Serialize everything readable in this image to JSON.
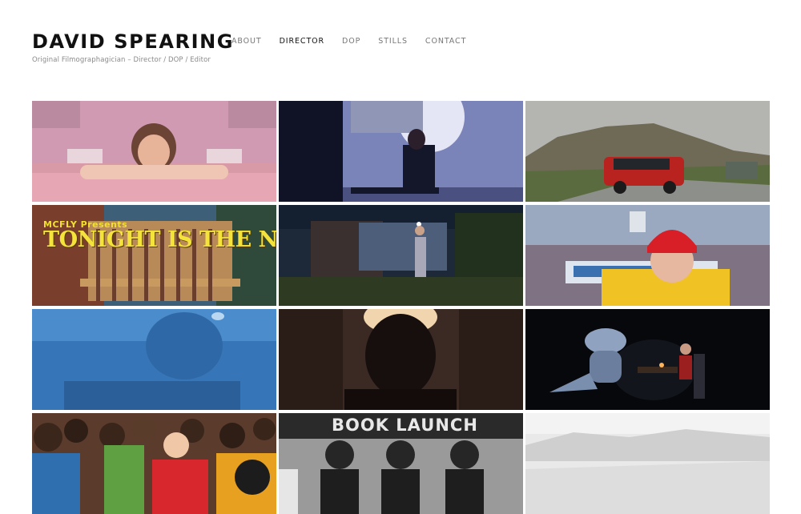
{
  "header": {
    "site_title": "DAVID SPEARING",
    "tagline": "Original Filmographagician – Director / DOP / Editor"
  },
  "nav": {
    "items": [
      {
        "label": "ABOUT",
        "active": false
      },
      {
        "label": "DIRECTOR",
        "active": true
      },
      {
        "label": "DOP",
        "active": false
      },
      {
        "label": "STILLS",
        "active": false
      },
      {
        "label": "CONTACT",
        "active": false
      }
    ]
  },
  "tiles": {
    "mcfly_presents": "MCFLY Presents",
    "tonight_title": "TONIGHT IS THE NIGHT",
    "book_launch": "BOOK LAUNCH"
  }
}
